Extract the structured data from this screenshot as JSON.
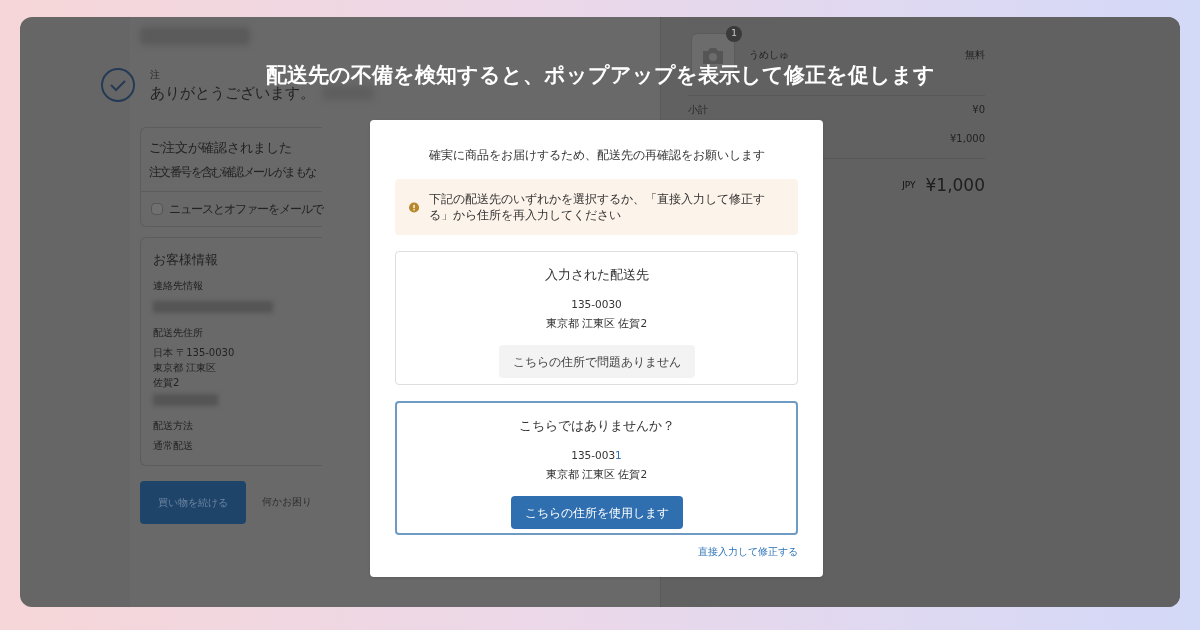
{
  "caption": "配送先の不備を検知すると、ポップアップを表示して修正を促します",
  "order": {
    "label": "注",
    "thanks": "ありがとうございます。"
  },
  "confirmed_card": {
    "title": "ご注文が確認されました",
    "body": "注文番号を含む確認メールがまもな",
    "newsletter": {
      "label": "ニュースとオファーをメールで",
      "checked": false
    }
  },
  "customer": {
    "title": "お客様情報",
    "sections": [
      {
        "kind": "contact",
        "heading": "連絡先情報"
      },
      {
        "kind": "address",
        "heading": "配送先住所",
        "lines": [
          "日本 〒135-0030",
          "東京都 江東区",
          "佐賀2"
        ]
      },
      {
        "kind": "shipping",
        "heading": "配送方法",
        "lines": [
          "通常配送"
        ]
      }
    ]
  },
  "continue_button": "買い物を続ける",
  "help_text": "何かお困り",
  "cart": {
    "badge": "1",
    "item": "うめしゅ",
    "price": "無料",
    "rows": [
      {
        "label": "小計",
        "value": "¥0"
      },
      {
        "label": "",
        "value": "¥1,000"
      }
    ],
    "currency": "JPY",
    "total": "¥1,000"
  },
  "modal": {
    "title": "確実に商品をお届けするため、配送先の再確認をお願いします",
    "notice": "下記の配送先のいずれかを選択するか、「直接入力して修正する」から住所を再入力してください",
    "options": [
      {
        "kind": "entered",
        "heading": "入力された配送先",
        "postal": [
          {
            "text": "135-0030",
            "changed": false
          }
        ],
        "address": "東京都 江東区 佐賀2",
        "button": "こちらの住所で問題ありません",
        "selected": false
      },
      {
        "kind": "suggested",
        "heading": "こちらではありませんか？",
        "postal": [
          {
            "text": "135-003",
            "changed": false
          },
          {
            "text": "1",
            "changed": true
          }
        ],
        "address": "東京都 江東区 佐賀2",
        "button": "こちらの住所を使用します",
        "selected": true
      }
    ],
    "edit_link": "直接入力して修正する"
  }
}
